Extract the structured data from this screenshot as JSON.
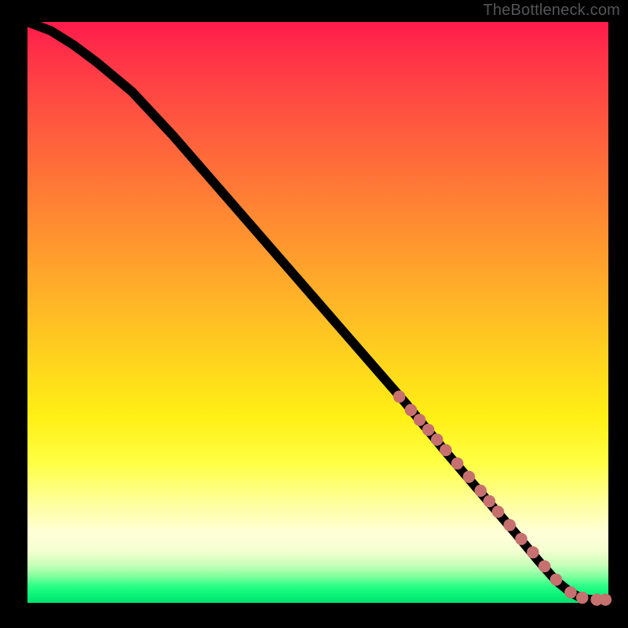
{
  "watermark": "TheBottleneck.com",
  "chart_data": {
    "type": "line",
    "title": "",
    "xlabel": "",
    "ylabel": "",
    "xlim": [
      0,
      100
    ],
    "ylim": [
      0,
      100
    ],
    "curve": {
      "x": [
        0,
        4,
        8,
        12,
        18,
        25,
        35,
        45,
        55,
        65,
        72,
        78,
        84,
        88,
        91,
        93.5,
        95,
        96.5,
        98,
        100
      ],
      "y": [
        100,
        98.5,
        96,
        93,
        88,
        80.5,
        69,
        57.5,
        46,
        34.5,
        26,
        19,
        12,
        7.2,
        3.8,
        1.8,
        1.0,
        0.6,
        0.5,
        0.5
      ]
    },
    "markers": {
      "x": [
        64,
        66,
        67.5,
        69,
        70.5,
        72,
        74,
        76,
        78,
        79.5,
        81,
        83,
        85,
        87,
        89,
        91,
        93.5,
        95.5,
        98,
        99.5
      ],
      "y": [
        35.5,
        33.2,
        31.5,
        29.8,
        28.1,
        26.3,
        24.0,
        21.7,
        19.3,
        17.5,
        15.7,
        13.4,
        11.0,
        8.7,
        6.3,
        4.0,
        1.8,
        0.9,
        0.55,
        0.55
      ]
    },
    "marker_color": "#c77070",
    "gradient_stops": [
      {
        "pos": 0.0,
        "color": "#ff1a4b"
      },
      {
        "pos": 0.32,
        "color": "#ff8433"
      },
      {
        "pos": 0.58,
        "color": "#ffd31e"
      },
      {
        "pos": 0.83,
        "color": "#ffffa0"
      },
      {
        "pos": 0.95,
        "color": "#7fff9e"
      },
      {
        "pos": 1.0,
        "color": "#00e06d"
      }
    ]
  }
}
